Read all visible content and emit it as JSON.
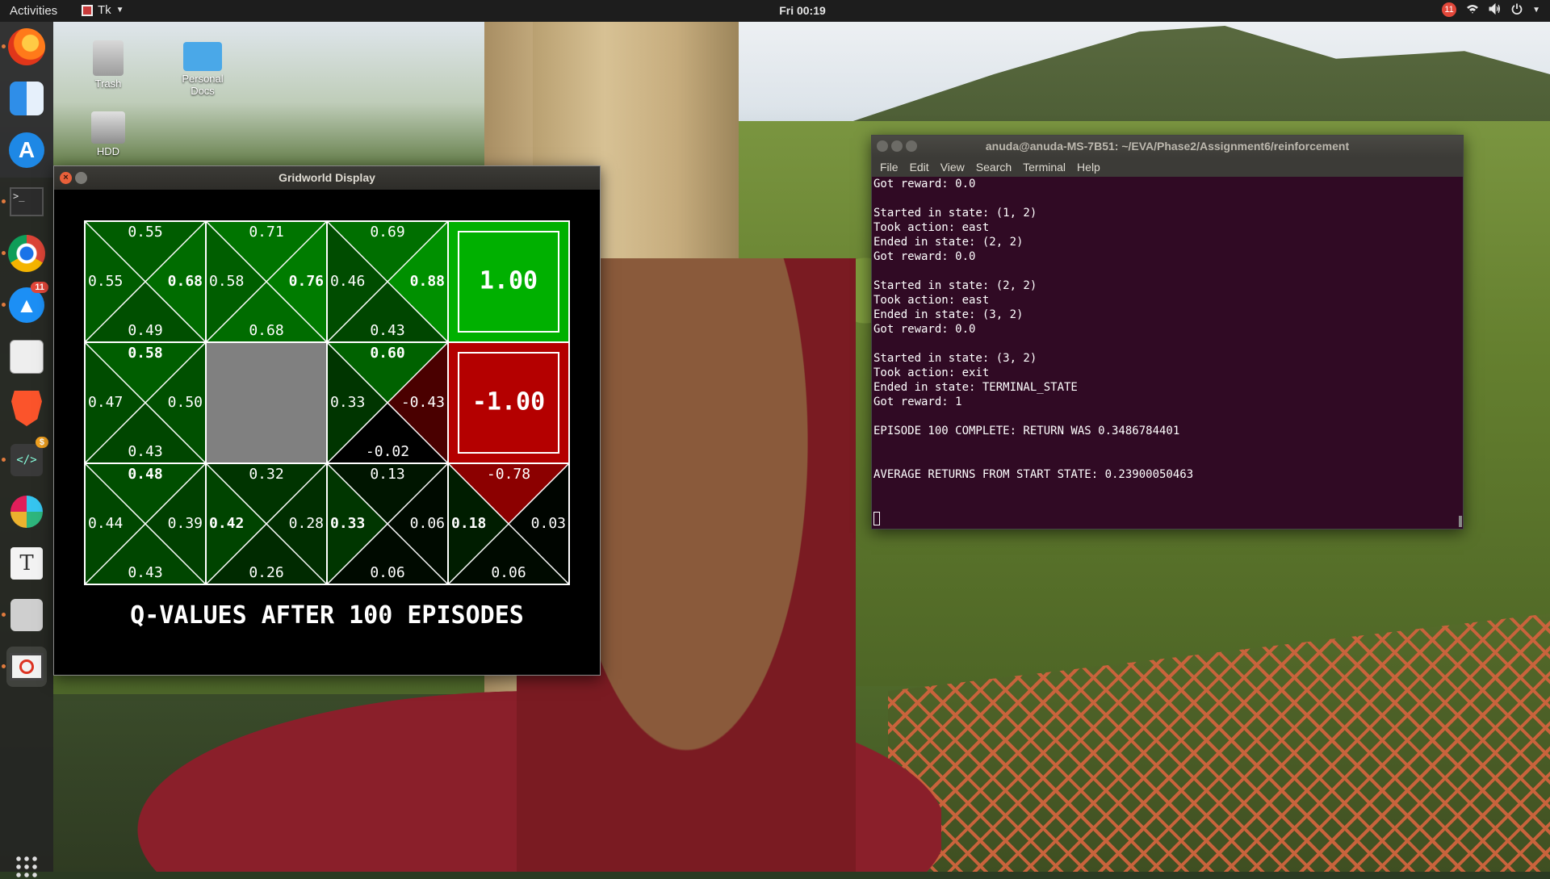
{
  "topbar": {
    "activities": "Activities",
    "app_name": "Tk",
    "clock": "Fri 00:19",
    "notification_count": "11"
  },
  "dock": {
    "items": [
      {
        "name": "firefox-icon"
      },
      {
        "name": "finder-icon"
      },
      {
        "name": "app-store-icon"
      },
      {
        "name": "terminal-icon"
      },
      {
        "name": "chrome-icon"
      },
      {
        "name": "delta-chat-icon",
        "badge": "11"
      },
      {
        "name": "text-editor-icon"
      },
      {
        "name": "brave-icon"
      },
      {
        "name": "code-editor-icon",
        "badge": "$"
      },
      {
        "name": "slack-icon"
      },
      {
        "name": "typora-icon",
        "glyph": "T"
      },
      {
        "name": "paint-icon"
      },
      {
        "name": "tk-app-icon"
      }
    ],
    "show_apps": "show-applications-icon"
  },
  "desktop": {
    "icons": [
      {
        "label": "Trash"
      },
      {
        "label": "Personal Docs"
      },
      {
        "label": "HDD"
      }
    ]
  },
  "gridworld": {
    "title": "Gridworld Display",
    "caption": "Q-VALUES AFTER 100 EPISODES",
    "colors": {
      "positive_strong": "#00b000",
      "positive_mid": "#007d00",
      "positive_dark": "#005a00",
      "negative_strong": "#b40000",
      "negative_dark": "#5a0000",
      "wall": "#808080",
      "grid_line": "#ffffff"
    },
    "cells": [
      {
        "row": 0,
        "col": 0,
        "type": "q",
        "north": "0.55",
        "west": "0.55",
        "east": "0.68",
        "south": "0.49",
        "best": "east",
        "shade": {
          "north": "#005c00",
          "west": "#005c00",
          "east": "#006c00",
          "south": "#004f00"
        }
      },
      {
        "row": 0,
        "col": 1,
        "type": "q",
        "north": "0.71",
        "west": "0.58",
        "east": "0.76",
        "south": "0.68",
        "best": "east",
        "shade": {
          "north": "#007400",
          "west": "#005e00",
          "east": "#007c00",
          "south": "#006c00"
        }
      },
      {
        "row": 0,
        "col": 2,
        "type": "q",
        "north": "0.69",
        "west": "0.46",
        "east": "0.88",
        "south": "0.43",
        "best": "east",
        "shade": {
          "north": "#006f00",
          "west": "#004c00",
          "east": "#009000",
          "south": "#004600"
        }
      },
      {
        "row": 0,
        "col": 3,
        "type": "terminal",
        "value": "1.00",
        "fill": "#00b000"
      },
      {
        "row": 1,
        "col": 0,
        "type": "q",
        "north": "0.58",
        "west": "0.47",
        "east": "0.50",
        "south": "0.43",
        "best": "north",
        "shade": {
          "north": "#005e00",
          "west": "#004c00",
          "east": "#005000",
          "south": "#004600"
        }
      },
      {
        "row": 1,
        "col": 1,
        "type": "wall"
      },
      {
        "row": 1,
        "col": 2,
        "type": "q",
        "north": "0.60",
        "west": "0.33",
        "east": "-0.43",
        "south": "-0.02",
        "best": "north",
        "shade": {
          "north": "#006200",
          "west": "#003500",
          "east": "#4a0000",
          "south": "#000000"
        }
      },
      {
        "row": 1,
        "col": 3,
        "type": "terminal",
        "value": "-1.00",
        "fill": "#b40000"
      },
      {
        "row": 2,
        "col": 0,
        "type": "q",
        "north": "0.48",
        "west": "0.44",
        "east": "0.39",
        "south": "0.43",
        "best": "north",
        "shade": {
          "north": "#004e00",
          "west": "#004700",
          "east": "#004000",
          "south": "#004600"
        }
      },
      {
        "row": 2,
        "col": 1,
        "type": "q",
        "north": "0.32",
        "west": "0.42",
        "east": "0.28",
        "south": "0.26",
        "best": "west",
        "shade": {
          "north": "#003400",
          "west": "#004400",
          "east": "#002e00",
          "south": "#002a00"
        }
      },
      {
        "row": 2,
        "col": 2,
        "type": "q",
        "north": "0.13",
        "west": "0.33",
        "east": "0.06",
        "south": "0.06",
        "best": "west",
        "shade": {
          "north": "#001500",
          "west": "#003600",
          "east": "#000a00",
          "south": "#000a00"
        }
      },
      {
        "row": 2,
        "col": 3,
        "type": "q",
        "north": "-0.78",
        "west": "0.18",
        "east": "0.03",
        "south": "0.06",
        "best": "west",
        "shade": {
          "north": "#8c0000",
          "west": "#001d00",
          "east": "#000500",
          "south": "#000a00"
        }
      }
    ]
  },
  "terminal": {
    "title": "anuda@anuda-MS-7B51: ~/EVA/Phase2/Assignment6/reinforcement",
    "menu": [
      "File",
      "Edit",
      "View",
      "Search",
      "Terminal",
      "Help"
    ],
    "lines": [
      "Got reward: 0.0",
      "",
      "Started in state: (1, 2)",
      "Took action: east",
      "Ended in state: (2, 2)",
      "Got reward: 0.0",
      "",
      "Started in state: (2, 2)",
      "Took action: east",
      "Ended in state: (3, 2)",
      "Got reward: 0.0",
      "",
      "Started in state: (3, 2)",
      "Took action: exit",
      "Ended in state: TERMINAL_STATE",
      "Got reward: 1",
      "",
      "EPISODE 100 COMPLETE: RETURN WAS 0.3486784401",
      "",
      "",
      "AVERAGE RETURNS FROM START STATE: 0.23900050463",
      "",
      ""
    ]
  }
}
